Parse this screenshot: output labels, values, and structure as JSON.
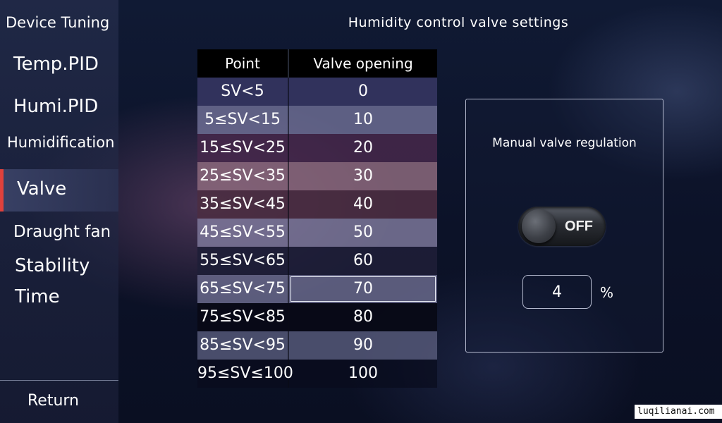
{
  "sidebar": {
    "header": "Device Tuning",
    "items": [
      {
        "label": "Temp.PID"
      },
      {
        "label": "Humi.PID"
      },
      {
        "label": "Humidification"
      },
      {
        "label": "Valve"
      },
      {
        "label": "Draught fan"
      },
      {
        "label": "Stability"
      },
      {
        "label": "Time"
      }
    ],
    "active": "Valve",
    "return_label": "Return"
  },
  "page": {
    "title": "Humidity control valve settings"
  },
  "table": {
    "headers": [
      "Point",
      "Valve opening"
    ],
    "rows": [
      {
        "point": "SV<5",
        "opening": "0"
      },
      {
        "point": "5≤SV<15",
        "opening": "10"
      },
      {
        "point": "15≤SV<25",
        "opening": "20"
      },
      {
        "point": "25≤SV<35",
        "opening": "30"
      },
      {
        "point": "35≤SV<45",
        "opening": "40"
      },
      {
        "point": "45≤SV<55",
        "opening": "50"
      },
      {
        "point": "55≤SV<65",
        "opening": "60"
      },
      {
        "point": "65≤SV<75",
        "opening": "70"
      },
      {
        "point": "75≤SV<85",
        "opening": "80"
      },
      {
        "point": "85≤SV<95",
        "opening": "90"
      },
      {
        "point": "95≤SV≤100",
        "opening": "100"
      }
    ],
    "selected_row": "65≤SV<75"
  },
  "manual": {
    "title": "Manual valve regulation",
    "toggle_label": "OFF",
    "value": "4",
    "unit": "%"
  },
  "watermark": "luqilianai.com",
  "colors": {
    "active_accent": "#e0413c"
  }
}
